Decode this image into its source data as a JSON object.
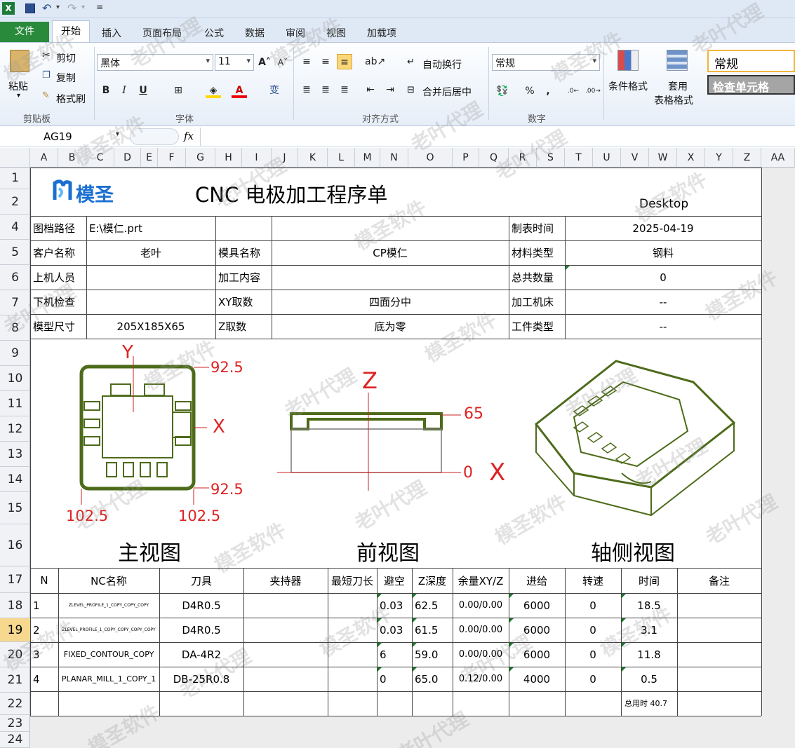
{
  "qat": {
    "icons": [
      "excel-logo-icon",
      "save-icon",
      "undo-icon",
      "redo-icon",
      "customize-icon"
    ]
  },
  "tabs": [
    "文件",
    "开始",
    "插入",
    "页面布局",
    "公式",
    "数据",
    "审阅",
    "视图",
    "加载项"
  ],
  "ribbon": {
    "clipboard": {
      "paste": "粘贴",
      "cut": "剪切",
      "copy": "复制",
      "format_painter": "格式刷",
      "group": "剪贴板"
    },
    "font": {
      "name": "黑体",
      "size": "11",
      "group": "字体"
    },
    "alignment": {
      "wrap": "自动换行",
      "merge": "合并后居中",
      "group": "对齐方式"
    },
    "number": {
      "format": "常规",
      "group": "数字"
    },
    "styles": {
      "conditional": "条件格式",
      "table_style_1": "套用",
      "table_style_2": "表格格式",
      "style_normal": "常规",
      "style_check": "检查单元格"
    }
  },
  "formula_bar": {
    "name_box": "AG19",
    "fx": "fx",
    "value": ""
  },
  "columns": [
    "A",
    "B",
    "C",
    "D",
    "E",
    "F",
    "G",
    "H",
    "I",
    "J",
    "K",
    "L",
    "M",
    "N",
    "O",
    "P",
    "Q",
    "R",
    "S",
    "T",
    "U",
    "V",
    "W",
    "X",
    "Y",
    "Z",
    "AA"
  ],
  "rows": [
    "1",
    "2",
    "4",
    "5",
    "6",
    "7",
    "8",
    "9",
    "10",
    "11",
    "12",
    "13",
    "14",
    "15",
    "16",
    "17",
    "18",
    "19",
    "20",
    "21",
    "22",
    "23",
    "24"
  ],
  "sheet": {
    "logo_text": "模圣",
    "title": "CNC 电极加工程序单",
    "desktop": "Desktop",
    "info": [
      {
        "l1": "图档路径",
        "v1": "E:\\模仁.prt",
        "l2": "",
        "v2": "",
        "l3": "制表时间",
        "v3": "2025-04-19"
      },
      {
        "l1": "客户名称",
        "v1": "老叶",
        "l2": "模具名称",
        "v2": "CP模仁",
        "l3": "材料类型",
        "v3": "钢料"
      },
      {
        "l1": "上机人员",
        "v1": "",
        "l2": "加工内容",
        "v2": "",
        "l3": "总共数量",
        "v3": "0"
      },
      {
        "l1": "下机检查",
        "v1": "",
        "l2": "XY取数",
        "v2": "四面分中",
        "l3": "加工机床",
        "v3": "--"
      },
      {
        "l1": "模型尺寸",
        "v1": "205X185X65",
        "l2": "Z取数",
        "v2": "底为零",
        "l3": "工件类型",
        "v3": "--"
      }
    ],
    "views": {
      "main": {
        "title": "主视图",
        "y": "Y",
        "x": "X",
        "top_right": "92.5",
        "bottom_right": "92.5",
        "bottom_left": "102.5",
        "bottom_right_x": "102.5"
      },
      "front": {
        "title": "前视图",
        "z": "Z",
        "x": "X",
        "top": "65",
        "bottom": "0"
      },
      "iso": {
        "title": "轴侧视图"
      }
    },
    "table_headers": [
      "N",
      "NC名称",
      "刀具",
      "夹持器",
      "最短刀长",
      "避空",
      "Z深度",
      "余量XY/Z",
      "进给",
      "转速",
      "时间",
      "备注"
    ],
    "table_rows": [
      {
        "n": "1",
        "nc": "ZLEVEL_PROFILE_1_COPY_COPY_COPY",
        "tool": "D4R0.5",
        "holder": "",
        "len": "",
        "clear": "0.03",
        "z": "62.5",
        "stock": "0.00/0.00",
        "feed": "6000",
        "speed": "0",
        "time": "18.5",
        "note": ""
      },
      {
        "n": "2",
        "nc": "ZLEVEL_PROFILE_1_COPY_COPY_COPY_COPY",
        "tool": "D4R0.5",
        "holder": "",
        "len": "",
        "clear": "0.03",
        "z": "61.5",
        "stock": "0.00/0.00",
        "feed": "6000",
        "speed": "0",
        "time": "3.1",
        "note": ""
      },
      {
        "n": "3",
        "nc": "FIXED_CONTOUR_COPY",
        "tool": "DA-4R2",
        "holder": "",
        "len": "",
        "clear": "6",
        "z": "59.0",
        "stock": "0.00/0.00",
        "feed": "6000",
        "speed": "0",
        "time": "11.8",
        "note": ""
      },
      {
        "n": "4",
        "nc": "PLANAR_MILL_1_COPY_1",
        "tool": "DB-25R0.8",
        "holder": "",
        "len": "",
        "clear": "0",
        "z": "65.0",
        "stock": "0.12/0.00",
        "feed": "4000",
        "speed": "0",
        "time": "0.5",
        "note": ""
      }
    ],
    "total": "总用时 40.7"
  },
  "watermarks": [
    "模圣软件",
    "老叶代理"
  ]
}
